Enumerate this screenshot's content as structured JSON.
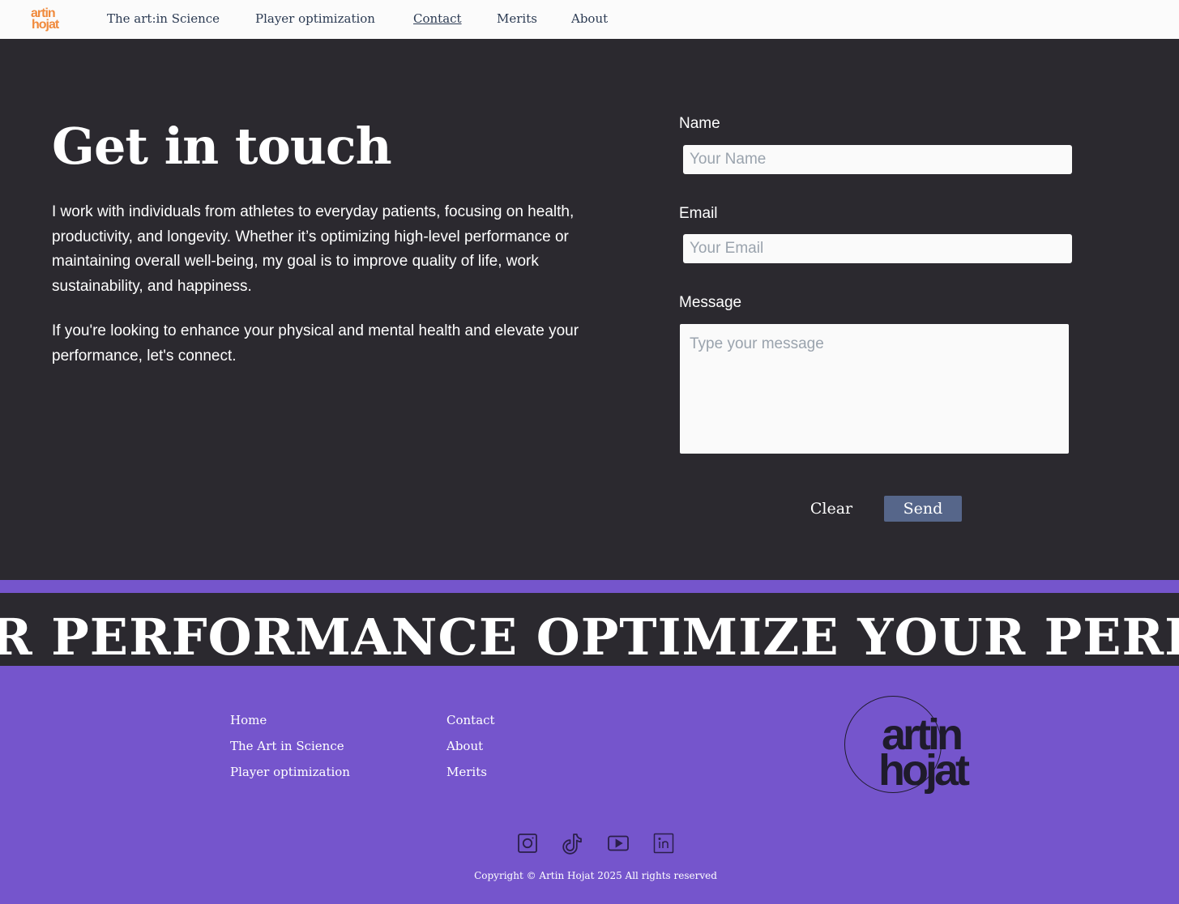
{
  "nav": {
    "logo_line1": "artin",
    "logo_line2": "hojat",
    "items": [
      {
        "label": "The art:in Science"
      },
      {
        "label": "Player optimization"
      },
      {
        "label": "Contact",
        "active": true
      },
      {
        "label": "Merits"
      },
      {
        "label": "About"
      }
    ]
  },
  "contact": {
    "heading": "Get in touch",
    "paragraph1": "I work with individuals from athletes to everyday patients, focusing on health, productivity, and longevity. Whether it’s optimizing high-level performance or maintaining overall well-being, my goal is to improve quality of life, work sustainability, and happiness.",
    "paragraph2": "If you're looking to enhance your physical and mental health and elevate your performance, let's connect.",
    "form": {
      "name_label": "Name",
      "name_placeholder": "Your Name",
      "email_label": "Email",
      "email_placeholder": "Your Email",
      "message_label": "Message",
      "message_placeholder": "Type your message",
      "clear_label": "Clear",
      "send_label": "Send"
    }
  },
  "marquee": {
    "text": "OUR PERFORMANCE OPTIMIZE YOUR PERFORMANCE"
  },
  "footer": {
    "col1": [
      "Home",
      "The Art in Science",
      "Player optimization"
    ],
    "col2": [
      "Contact",
      "About",
      "Merits"
    ],
    "logo_line1": "artin",
    "logo_line2": "hojat",
    "social": [
      "instagram-icon",
      "tiktok-icon",
      "youtube-icon",
      "linkedin-icon"
    ],
    "copyright": "Copyright © Artin Hojat 2025 All rights reserved"
  },
  "colors": {
    "dark_bg": "#2b292f",
    "purple": "#7555cc",
    "accent_orange": "#f08a3c",
    "send_button": "#56668a"
  }
}
